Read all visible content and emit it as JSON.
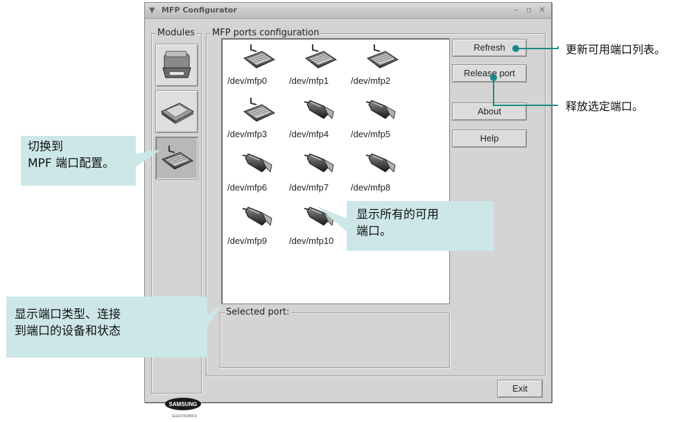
{
  "window": {
    "title": "MFP Configurator",
    "min_icon": "minimize-icon",
    "max_icon": "maximize-icon",
    "close_icon": "close-icon"
  },
  "modules": {
    "legend": "Modules",
    "items": [
      {
        "name": "printer-module",
        "icon": "printer-icon",
        "selected": false
      },
      {
        "name": "scanner-module",
        "icon": "scanner-icon",
        "selected": false
      },
      {
        "name": "ports-module",
        "icon": "port-cable-icon",
        "selected": true
      }
    ]
  },
  "ports_config": {
    "legend": "MFP ports configuration",
    "ports": [
      {
        "label": "/dev/mfp0",
        "type": "parallel"
      },
      {
        "label": "/dev/mfp1",
        "type": "parallel"
      },
      {
        "label": "/dev/mfp2",
        "type": "parallel"
      },
      {
        "label": "/dev/mfp3",
        "type": "parallel"
      },
      {
        "label": "/dev/mfp4",
        "type": "usb"
      },
      {
        "label": "/dev/mfp5",
        "type": "usb"
      },
      {
        "label": "/dev/mfp6",
        "type": "usb"
      },
      {
        "label": "/dev/mfp7",
        "type": "usb"
      },
      {
        "label": "/dev/mfp8",
        "type": "usb"
      },
      {
        "label": "/dev/mfp9",
        "type": "usb"
      },
      {
        "label": "/dev/mfp10",
        "type": "usb"
      }
    ]
  },
  "selected_port": {
    "legend": "Selected port:"
  },
  "buttons": {
    "refresh": "Refresh",
    "release_port": "Release port",
    "about": "About",
    "help": "Help",
    "exit": "Exit"
  },
  "logo": {
    "brand": "SAMSUNG",
    "sub": "ELECTRONICS"
  },
  "annotations": {
    "refresh_note": "更新可用端口列表。",
    "release_note": "释放选定端口。",
    "switch_line1": "切换到",
    "switch_line2": "MPF 端口配置。",
    "show_line1": "显示所有的可用",
    "show_line2": "端口。",
    "type_line1": "显示端口类型、连接",
    "type_line2": "到端口的设备和状态"
  },
  "colors": {
    "callout_bg": "#cde7e8",
    "window_bg": "#d4d4d4",
    "accent": "#1a8a8a"
  }
}
